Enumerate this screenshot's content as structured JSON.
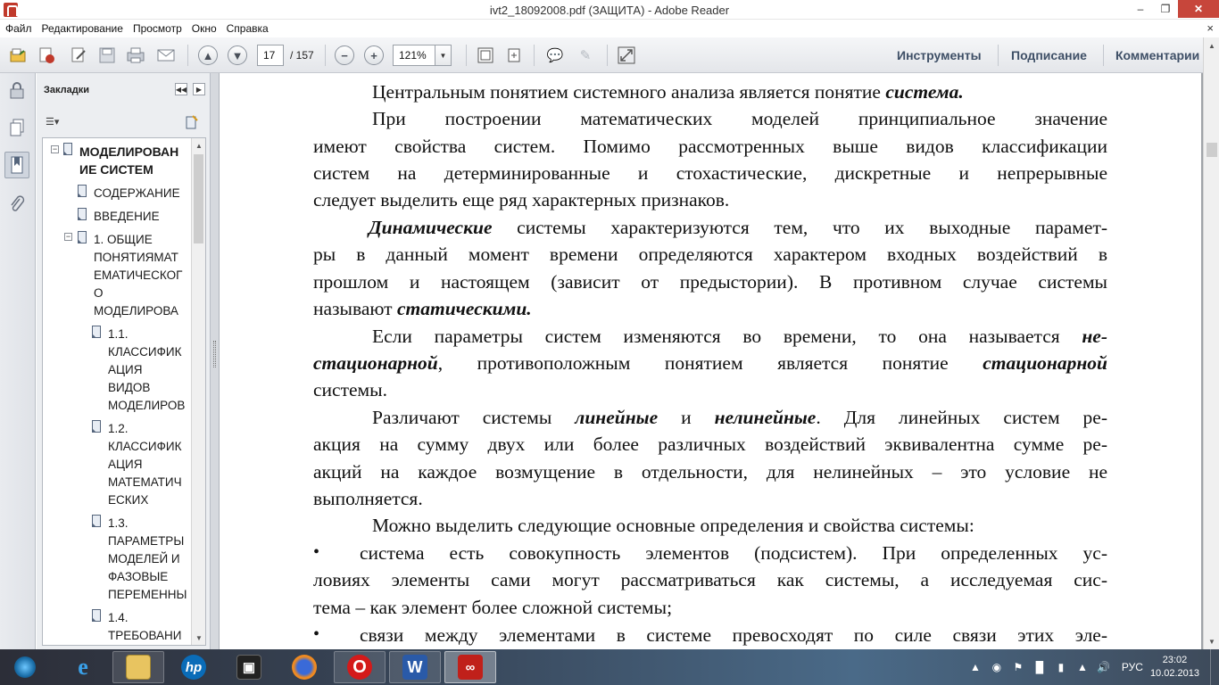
{
  "window": {
    "title": "ivt2_18092008.pdf (ЗАЩИТА) - Adobe Reader",
    "minimize": "–",
    "maximize": "❐",
    "close": "✕"
  },
  "menu": {
    "items": [
      "Файл",
      "Редактирование",
      "Просмотр",
      "Окно",
      "Справка"
    ],
    "close_glyph": "×"
  },
  "toolbar": {
    "page_current": "17",
    "page_total": "/ 157",
    "zoom": "121%",
    "tools_label": "Инструменты",
    "sign_label": "Подписание",
    "comment_label": "Комментарии"
  },
  "bookmarks": {
    "title": "Закладки",
    "items": [
      {
        "lines": [
          "МОДЕЛИРОВАН",
          "ИЕ СИСТЕМ"
        ]
      },
      {
        "lines": [
          "СОДЕРЖАНИЕ"
        ]
      },
      {
        "lines": [
          "ВВЕДЕНИЕ"
        ]
      },
      {
        "lines": [
          "1. ОБЩИЕ",
          "ПОНЯТИЯМАТ",
          "ЕМАТИЧЕСКОГ",
          "О",
          "МОДЕЛИРОВА"
        ]
      },
      {
        "lines": [
          "1.1.",
          "КЛАССИФИК",
          "АЦИЯ",
          "ВИДОВ",
          "МОДЕЛИРОВ"
        ]
      },
      {
        "lines": [
          "1.2.",
          "КЛАССИФИК",
          "АЦИЯ",
          "МАТЕМАТИЧ",
          "ЕСКИХ"
        ]
      },
      {
        "lines": [
          "1.3.",
          "ПАРАМЕТРЫ",
          "МОДЕЛЕЙ И",
          "ФАЗОВЫЕ",
          "ПЕРЕМЕННЫ"
        ]
      },
      {
        "lines": [
          "1.4.",
          "ТРЕБОВАНИ"
        ]
      }
    ]
  },
  "document": {
    "p1": {
      "text": "Центральным понятием системного анализа является понятие ",
      "bold": "система."
    },
    "p2": [
      "При построении математических моделей принципиальное значение",
      "имеют свойства систем. Помимо рассмотренных выше видов классификации",
      "систем на детерминированные и стохастические, дискретные и непрерывные",
      "следует выделить еще ряд характерных признаков."
    ],
    "p3": {
      "bold": "Динамические",
      "l1": " системы характеризуются тем, что их выходные парамет-",
      "l2": "ры в данный момент времени определяются характером входных воздействий в",
      "l3": "прошлом и настоящем (зависит от предыстории). В противном случае системы",
      "l4a": "называют ",
      "l4b": "статическими."
    },
    "p4": {
      "l1a": "Если параметры систем изменяются во времени, то она называется ",
      "l1b": "не-",
      "l2a": "стационарной",
      "l2b": ", противоположным понятием является понятие ",
      "l2c": "стационарной",
      "l3": "системы."
    },
    "p5": {
      "l1a": "Различают системы ",
      "l1b": "линейные",
      "l1c": " и ",
      "l1d": "нелинейные",
      "l1e": ". Для линейных систем ре-",
      "l2": "акция на сумму двух или более различных воздействий эквивалентна сумме ре-",
      "l3": "акций на каждое возмущение в отдельности, для нелинейных – это условие не",
      "l4": "выполняется."
    },
    "p6": "Можно выделить следующие основные определения и свойства системы:",
    "bullet_glyph": "•",
    "b1": [
      "система есть совокупность элементов (подсистем). При определенных ус-",
      "ловиях элементы сами могут рассматриваться как системы, а исследуемая сис-",
      "тема – как элемент более сложной системы;"
    ],
    "b2": [
      "связи между элементами в системе превосходят по силе связи этих эле-"
    ]
  },
  "taskbar": {
    "lang": "РУС",
    "time": "23:02",
    "date": "10.02.2013"
  },
  "colors": {
    "close_button": "#c7463b",
    "toolbar_link": "#3e4f66",
    "doc_background": "#9fa3a8"
  },
  "icons": [
    "open-file-icon",
    "create-pdf-icon",
    "edit-icon",
    "save-icon",
    "print-icon",
    "email-icon",
    "page-up-icon",
    "page-down-icon",
    "zoom-out-icon",
    "zoom-in-icon",
    "fit-page-icon",
    "rotate-icon",
    "comment-icon",
    "highlight-icon",
    "fullscreen-icon"
  ]
}
